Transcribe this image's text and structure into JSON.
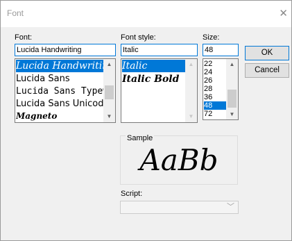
{
  "window": {
    "title": "Font",
    "close_glyph": "✕"
  },
  "font": {
    "label": "Font:",
    "value": "Lucida Handwriting",
    "items": [
      "Lucida Handwriting",
      "Lucida Sans",
      "Lucida Sans Typewriter",
      "Lucida Sans Unicode",
      "Magneto"
    ],
    "selected_index": 0
  },
  "style": {
    "label": "Font style:",
    "value": "Italic",
    "items": [
      "Italic",
      "Italic Bold"
    ],
    "selected_index": 0
  },
  "size": {
    "label": "Size:",
    "value": "48",
    "items": [
      "22",
      "24",
      "26",
      "28",
      "36",
      "48",
      "72"
    ],
    "selected_index": 5
  },
  "buttons": {
    "ok": "OK",
    "cancel": "Cancel"
  },
  "sample": {
    "label": "Sample",
    "text": "AaBb"
  },
  "script": {
    "label": "Script:",
    "value": ""
  },
  "colors": {
    "accent": "#0078d7",
    "dialog_bg": "#f0f0f0"
  },
  "icons": {
    "scroll_up": "chevron-up-icon",
    "scroll_down": "chevron-down-icon",
    "dropdown": "chevron-down-icon"
  }
}
